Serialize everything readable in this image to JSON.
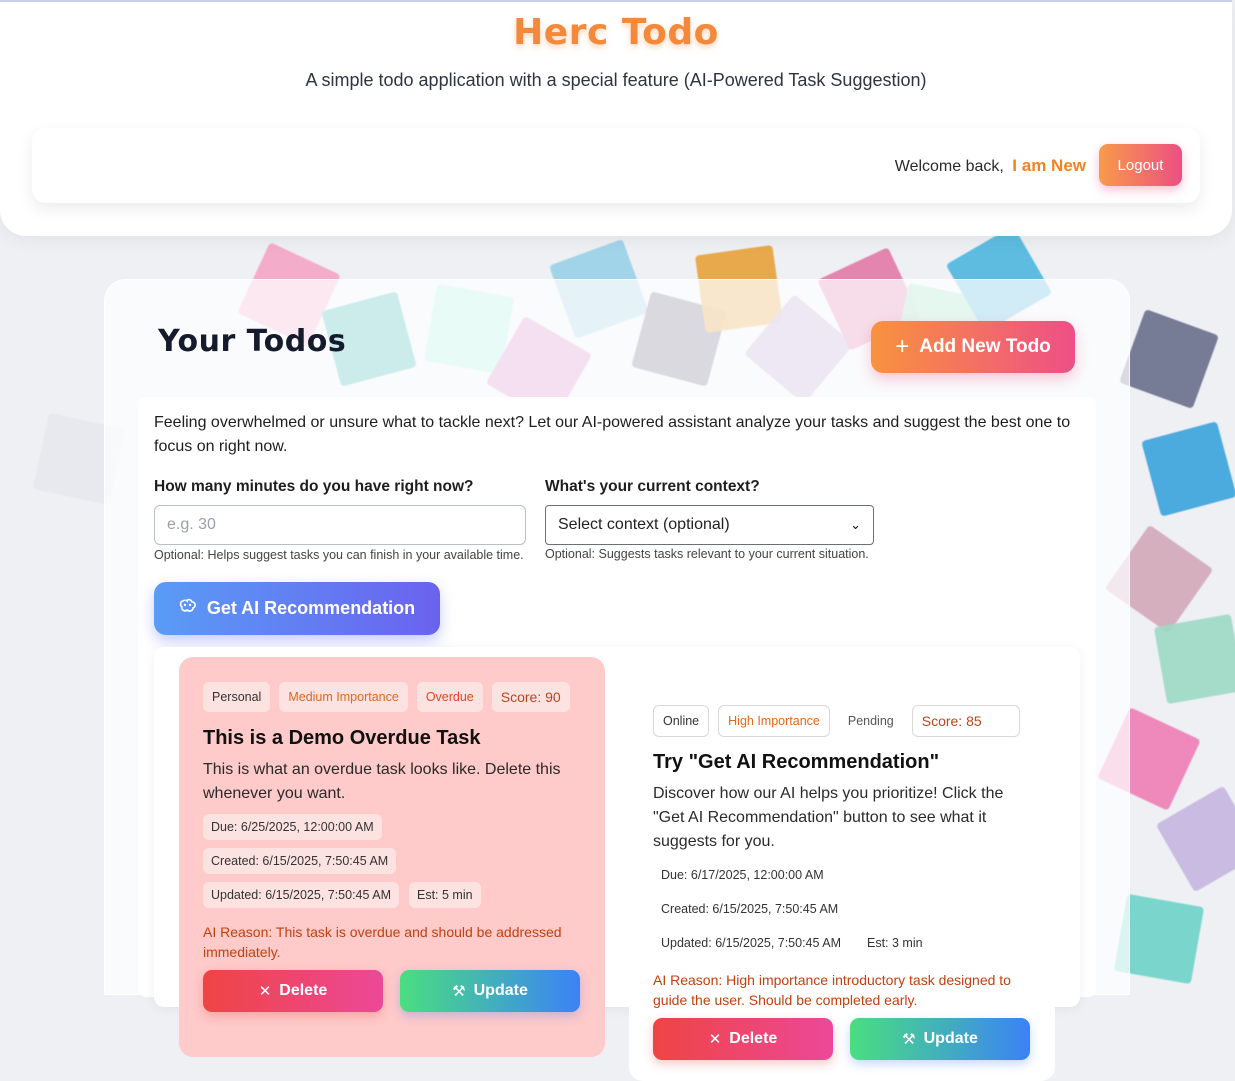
{
  "header": {
    "title": "Herc Todo",
    "subtitle": "A simple todo application with a special feature (AI-Powered Task Suggestion)",
    "welcome_text": "Welcome back,",
    "user_name": "I am New",
    "logout_label": "Logout"
  },
  "main": {
    "title": "Your Todos",
    "add_button": "Add New Todo",
    "ai_panel": {
      "description": "Feeling overwhelmed or unsure what to tackle next? Let our AI-powered assistant analyze your tasks and suggest the best one to focus on right now.",
      "minutes_label": "How many minutes do you have right now?",
      "minutes_placeholder": "e.g. 30",
      "minutes_hint": "Optional: Helps suggest tasks you can finish in your available time.",
      "context_label": "What's your current context?",
      "context_selected": "Select context (optional)",
      "context_hint": "Optional: Suggests tasks relevant to your current situation.",
      "ai_button": "Get AI Recommendation"
    },
    "todos": [
      {
        "category": "Personal",
        "importance": "Medium Importance",
        "status": "Overdue",
        "score": "Score: 90",
        "title": "This is a Demo Overdue Task",
        "description": "This is what an overdue task looks like. Delete this whenever you want.",
        "due": "Due: 6/25/2025, 12:00:00 AM",
        "created": "Created: 6/15/2025, 7:50:45 AM",
        "updated": "Updated: 6/15/2025, 7:50:45 AM",
        "estimate": "Est: 5 min",
        "ai_reason": "AI Reason: This task is overdue and should be addressed immediately.",
        "delete_label": "Delete",
        "update_label": "Update"
      },
      {
        "category": "Online",
        "importance": "High Importance",
        "status": "Pending",
        "score": "Score: 85",
        "title": "Try \"Get AI Recommendation\"",
        "description": "Discover how our AI helps you prioritize! Click the \"Get AI Recommendation\" button to see what it suggests for you.",
        "due": "Due: 6/17/2025, 12:00:00 AM",
        "created": "Created: 6/15/2025, 7:50:45 AM",
        "updated": "Updated: 6/15/2025, 7:50:45 AM",
        "estimate": "Est: 3 min",
        "ai_reason": "AI Reason: High importance introductory task designed to guide the user. Should be completed early.",
        "delete_label": "Delete",
        "update_label": "Update"
      }
    ]
  },
  "icons": {
    "plus": "plus-icon",
    "ai": "brain-icon",
    "delete": "close-icon",
    "update": "tool-icon"
  },
  "colors": {
    "title_orange": "#f5893b",
    "accent_pink": "#ec4f82",
    "ai_blue": "#5a9cf6",
    "overdue_card_bg": "#fecaca",
    "ai_reason": "#c2410c"
  }
}
